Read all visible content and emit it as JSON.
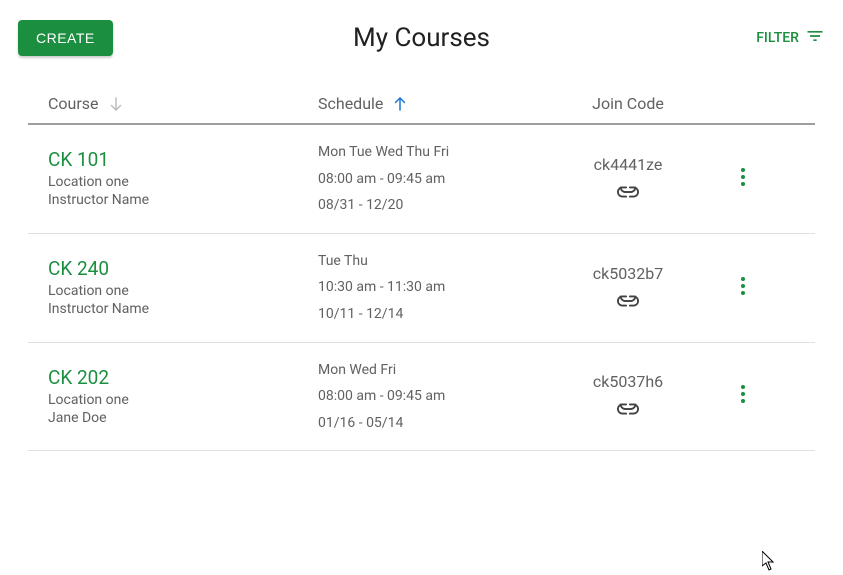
{
  "header": {
    "create_label": "CREATE",
    "title": "My Courses",
    "filter_label": "FILTER"
  },
  "columns": {
    "course": "Course",
    "schedule": "Schedule",
    "join_code": "Join Code"
  },
  "courses": [
    {
      "title": "CK 101",
      "location": "Location one",
      "instructor": "Instructor Name",
      "days": "Mon Tue Wed Thu Fri",
      "time": "08:00 am - 09:45 am",
      "dates": "08/31 - 12/20",
      "join_code": "ck4441ze"
    },
    {
      "title": "CK 240",
      "location": "Location one",
      "instructor": "Instructor Name",
      "days": "Tue Thu",
      "time": "10:30 am - 11:30 am",
      "dates": "10/11 - 12/14",
      "join_code": "ck5032b7"
    },
    {
      "title": "CK 202",
      "location": "Location one",
      "instructor": "Jane Doe",
      "days": "Mon Wed Fri",
      "time": "08:00 am - 09:45 am",
      "dates": "01/16 - 05/14",
      "join_code": "ck5037h6"
    }
  ]
}
